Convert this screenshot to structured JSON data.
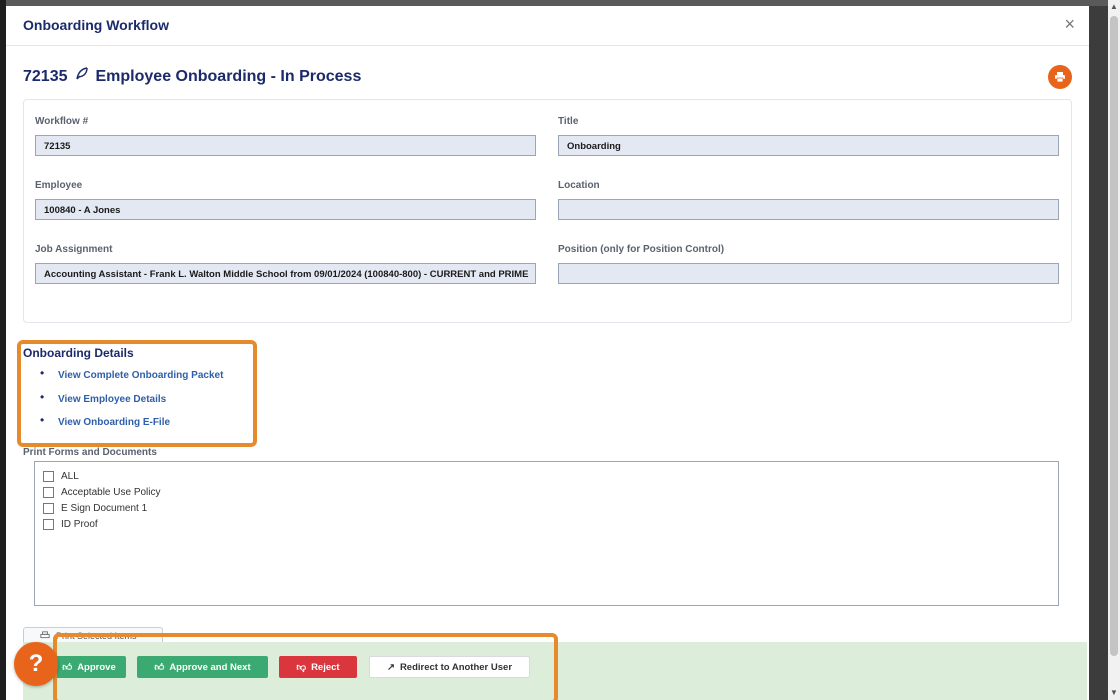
{
  "modal": {
    "title": "Onboarding Workflow",
    "close": "×"
  },
  "heading": {
    "id": "72135",
    "text": "Employee Onboarding - In Process"
  },
  "fields": {
    "workflow": {
      "label": "Workflow #",
      "value": "72135"
    },
    "title": {
      "label": "Title",
      "value": "Onboarding"
    },
    "employee": {
      "label": "Employee",
      "value": "100840 - A Jones"
    },
    "location": {
      "label": "Location",
      "value": ""
    },
    "job": {
      "label": "Job Assignment",
      "value": "Accounting Assistant - Frank L. Walton Middle School from 09/01/2024 (100840-800) - CURRENT and PRIME"
    },
    "position": {
      "label": "Position (only for Position Control)",
      "value": ""
    }
  },
  "details": {
    "title": "Onboarding Details",
    "links": [
      "View Complete Onboarding Packet",
      "View Employee Details",
      "View Onboarding E-File"
    ]
  },
  "forms": {
    "label": "Print Forms and Documents",
    "items": [
      "ALL",
      "Acceptable Use Policy",
      "E Sign Document 1",
      "ID Proof"
    ],
    "print_selected": "Print Selected Items"
  },
  "actions": {
    "approve": "Approve",
    "approve_next": "Approve and Next",
    "reject": "Reject",
    "redirect": "Redirect to Another User"
  },
  "help": {
    "label": "?"
  },
  "colors": {
    "primary": "#1b2a6b",
    "accent": "#e8641b",
    "approve": "#3aaa72",
    "reject": "#d9363e",
    "highlight": "#e68a2e"
  }
}
